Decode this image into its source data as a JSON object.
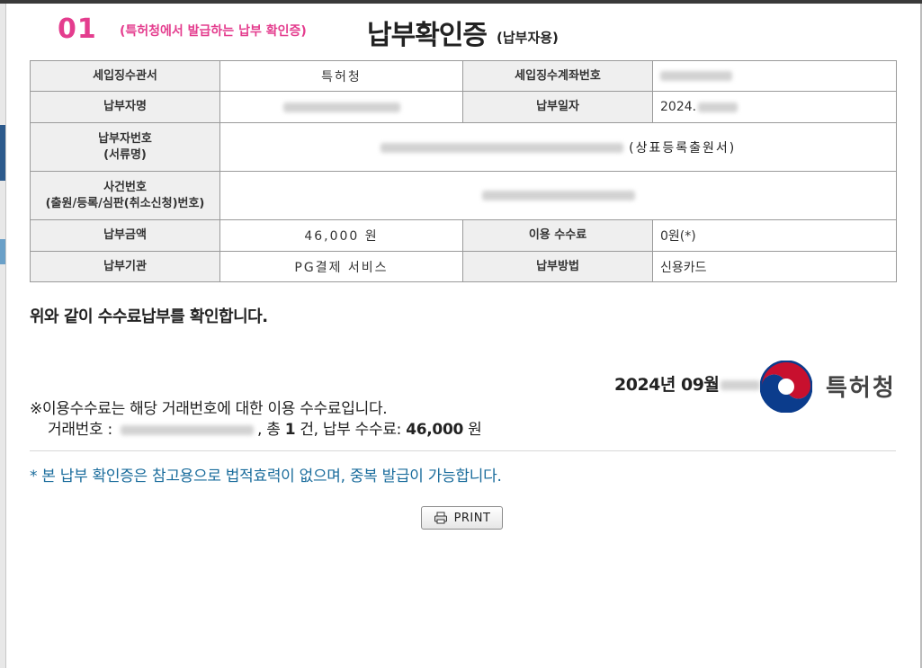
{
  "header": {
    "step_number": "01",
    "step_note": "(특허청에서 발급하는 납부 확인증)",
    "title": "납부확인증",
    "subtitle": "(납부자용)"
  },
  "table": {
    "collecting_office_label": "세입징수관서",
    "collecting_office_value": "특허청",
    "account_number_label": "세입징수계좌번호",
    "payer_name_label": "납부자명",
    "payment_date_label": "납부일자",
    "payment_date_value": "2024.",
    "payer_number_label_1": "납부자번호",
    "payer_number_label_2": "(서류명)",
    "document_name_value": "(상표등록출원서)",
    "case_number_label_1": "사건번호",
    "case_number_label_2": "(출원/등록/심판(취소신청)번호)",
    "amount_label": "납부금액",
    "amount_value": "46,000 원",
    "usage_fee_label": "이용 수수료",
    "usage_fee_value": "0원(*)",
    "institution_label": "납부기관",
    "institution_value": "PG결제 서비스",
    "method_label": "납부방법",
    "method_value": "신용카드"
  },
  "body": {
    "confirm_text": "위와 같이 수수료납부를 확인합니다.",
    "issue_date": "2024년 09월",
    "issuer_name": "특허청",
    "note_line_1": "※이용수수료는 해당 거래번호에 대한 이용 수수료입니다.",
    "transaction_label": "거래번호 :",
    "total_prefix": ", 총",
    "total_count": "1",
    "total_suffix": "건, 납부 수수료:",
    "total_fee": "46,000",
    "fee_unit": "원",
    "disclaimer": "* 본 납부 확인증은 참고용으로 법적효력이 없으며, 중복 발급이 가능합니다."
  },
  "actions": {
    "print_label": "PRINT"
  },
  "colors": {
    "accent_pink": "#e43d8e",
    "disclaimer_blue": "#1a6c9c",
    "seal_red": "#c8102e",
    "seal_blue": "#0b3c8c"
  }
}
